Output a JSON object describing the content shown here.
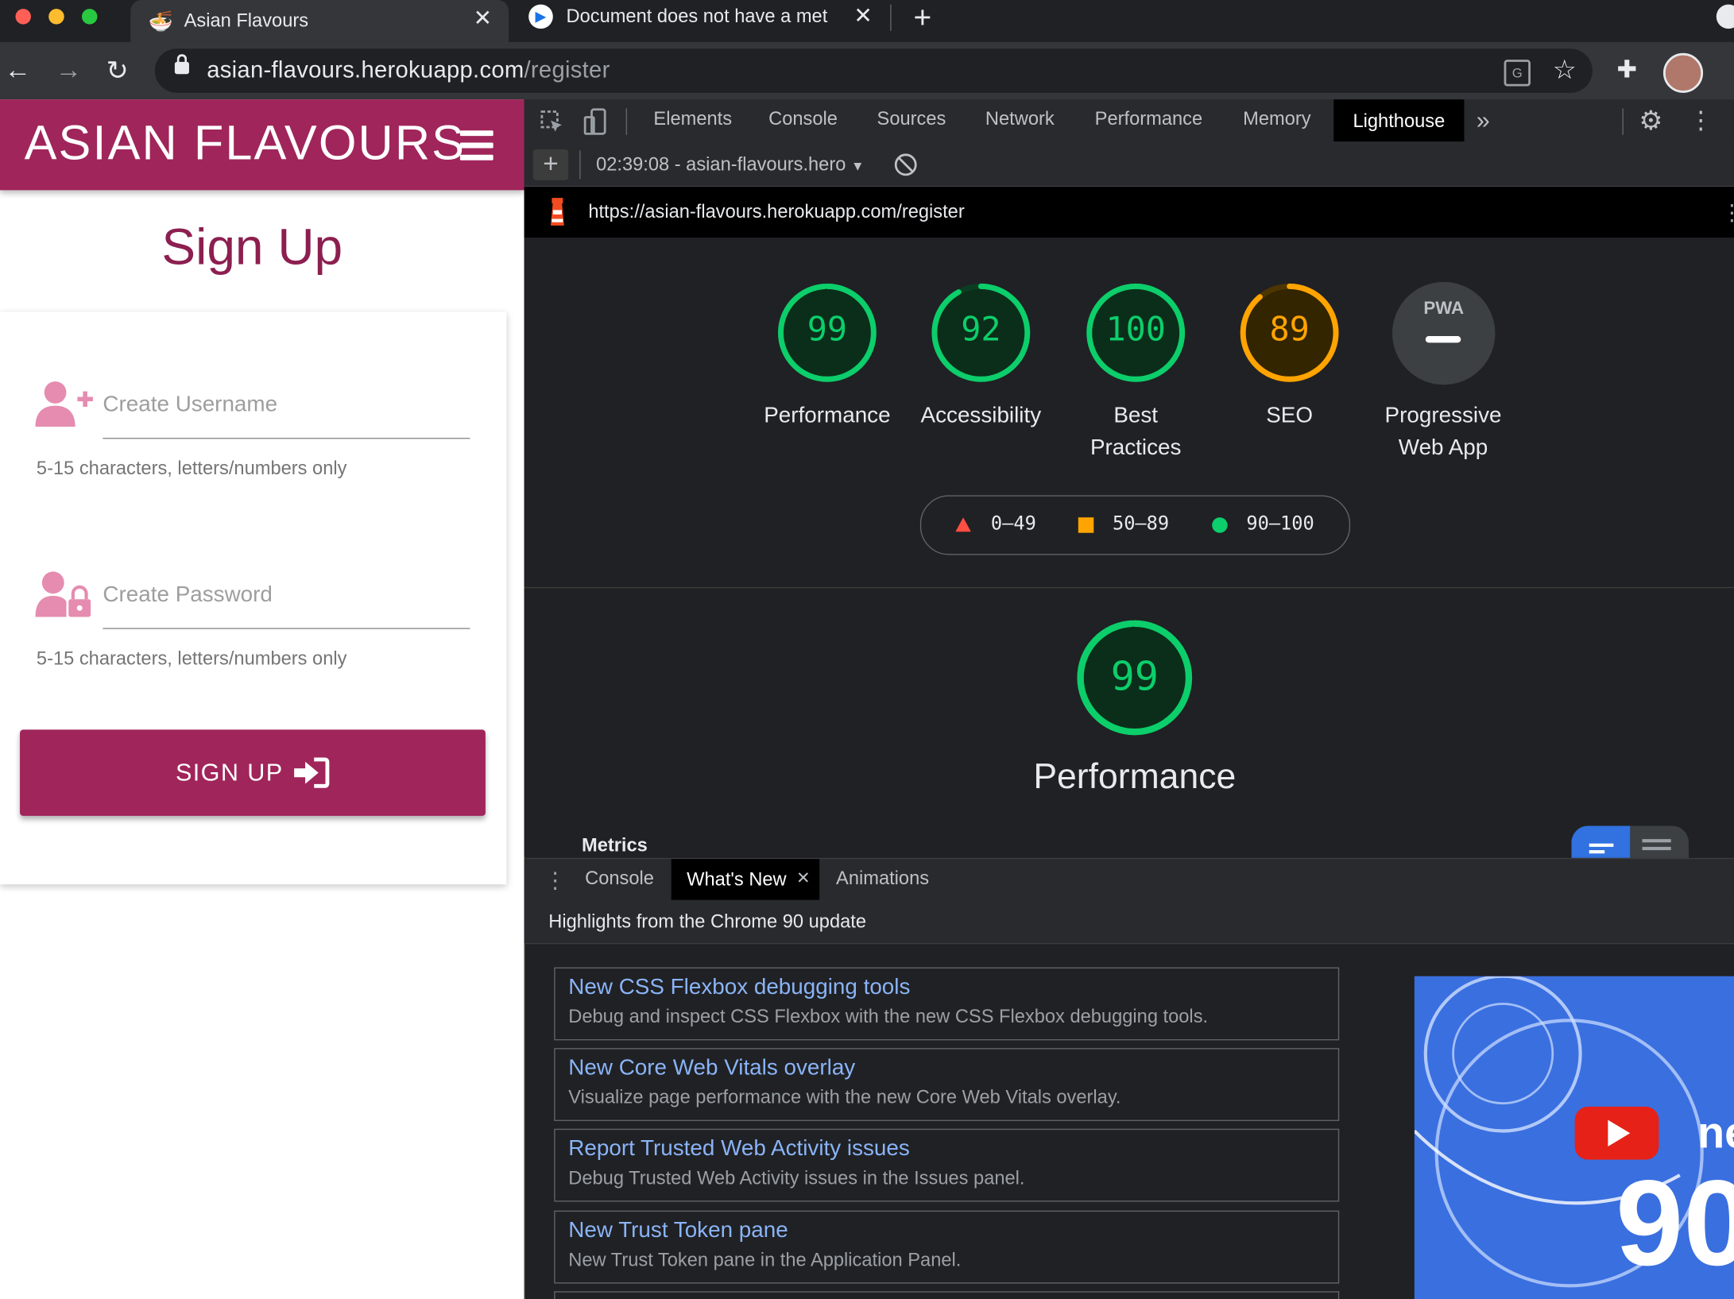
{
  "browser": {
    "tabs": [
      {
        "title": "Asian Flavours",
        "icon": "noodle-bowl-icon"
      },
      {
        "title": "Document does not have a met",
        "icon": "devtools-icon"
      }
    ],
    "url_host": "asian-flavours.herokuapp.com",
    "url_path": "/register"
  },
  "site": {
    "brand": "ASIAN FLAVOURS",
    "heading": "Sign Up",
    "username_placeholder": "Create Username",
    "username_helper": "5-15 characters, letters/numbers only",
    "password_placeholder": "Create Password",
    "password_helper": "5-15 characters, letters/numbers only",
    "submit_label": "SIGN UP",
    "accent_color": "#a0255a"
  },
  "devtools": {
    "panels": [
      "Elements",
      "Console",
      "Sources",
      "Network",
      "Performance",
      "Memory",
      "Lighthouse"
    ],
    "active_panel": "Lighthouse",
    "report_selector": "02:39:08 - asian-flavours.hero",
    "report_url": "https://asian-flavours.herokuapp.com/register",
    "scores": [
      {
        "label": "Performance",
        "score": 99,
        "color": "#0cce6b"
      },
      {
        "label": "Accessibility",
        "score": 92,
        "color": "#0cce6b"
      },
      {
        "label": "Best Practices",
        "score": 100,
        "color": "#0cce6b"
      },
      {
        "label": "SEO",
        "score": 89,
        "color": "#ffa400"
      }
    ],
    "pwa": {
      "badge": "PWA",
      "label": "Progressive Web App"
    },
    "legend": [
      {
        "range": "0–49",
        "shape": "triangle",
        "color": "#ff4e42"
      },
      {
        "range": "50–89",
        "shape": "square",
        "color": "#ffa400"
      },
      {
        "range": "90–100",
        "shape": "circle",
        "color": "#0cce6b"
      }
    ],
    "main_score": {
      "score": 99,
      "label": "Performance"
    },
    "metrics_heading": "Metrics",
    "drawer": {
      "tabs": [
        "Console",
        "What's New",
        "Animations"
      ],
      "active": "What's New",
      "highlights": "Highlights from the Chrome 90 update",
      "items": [
        {
          "title": "New CSS Flexbox debugging tools",
          "desc": "Debug and inspect CSS Flexbox with the new CSS Flexbox debugging tools."
        },
        {
          "title": "New Core Web Vitals overlay",
          "desc": "Visualize page performance with the new Core Web Vitals overlay."
        },
        {
          "title": "Report Trusted Web Activity issues",
          "desc": "Debug Trusted Web Activity issues in the Issues panel."
        },
        {
          "title": "New Trust Token pane",
          "desc": "New Trust Token pane in the Application Panel."
        }
      ],
      "video_text": [
        "ne",
        "90"
      ]
    }
  }
}
